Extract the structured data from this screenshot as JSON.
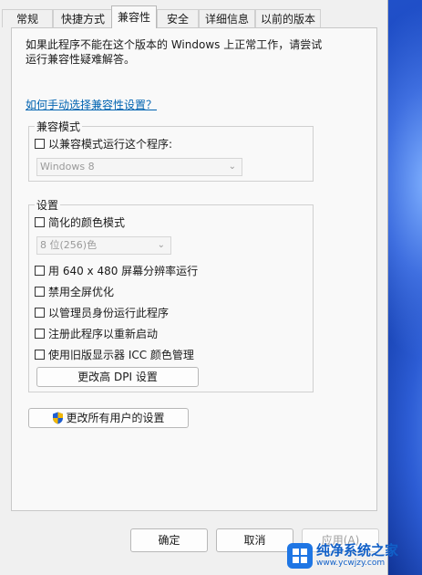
{
  "tabs": [
    "常规",
    "快捷方式",
    "兼容性",
    "安全",
    "详细信息",
    "以前的版本"
  ],
  "intro": "如果此程序不能在这个版本的 Windows 上正常工作，请尝试运行兼容性疑难解答。",
  "help_link": "如何手动选择兼容性设置？",
  "compat_mode": {
    "title": "兼容模式",
    "checkbox": "以兼容模式运行这个程序:",
    "os_value": "Windows 8"
  },
  "settings": {
    "title": "设置",
    "reduced_color": "简化的颜色模式",
    "color_value": "8 位(256)色",
    "res_640": "用 640 x 480 屏幕分辨率运行",
    "disable_fullscreen": "禁用全屏优化",
    "run_as_admin": "以管理员身份运行此程序",
    "register_restart": "注册此程序以重新启动",
    "legacy_icc": "使用旧版显示器 ICC 颜色管理",
    "dpi_button": "更改高 DPI 设置"
  },
  "all_users_button": "更改所有用户的设置",
  "buttons": {
    "ok": "确定",
    "cancel": "取消",
    "apply": "应用(A)"
  },
  "watermark": {
    "title": "纯净系统之家",
    "url": "www.ycwjzy.com"
  }
}
